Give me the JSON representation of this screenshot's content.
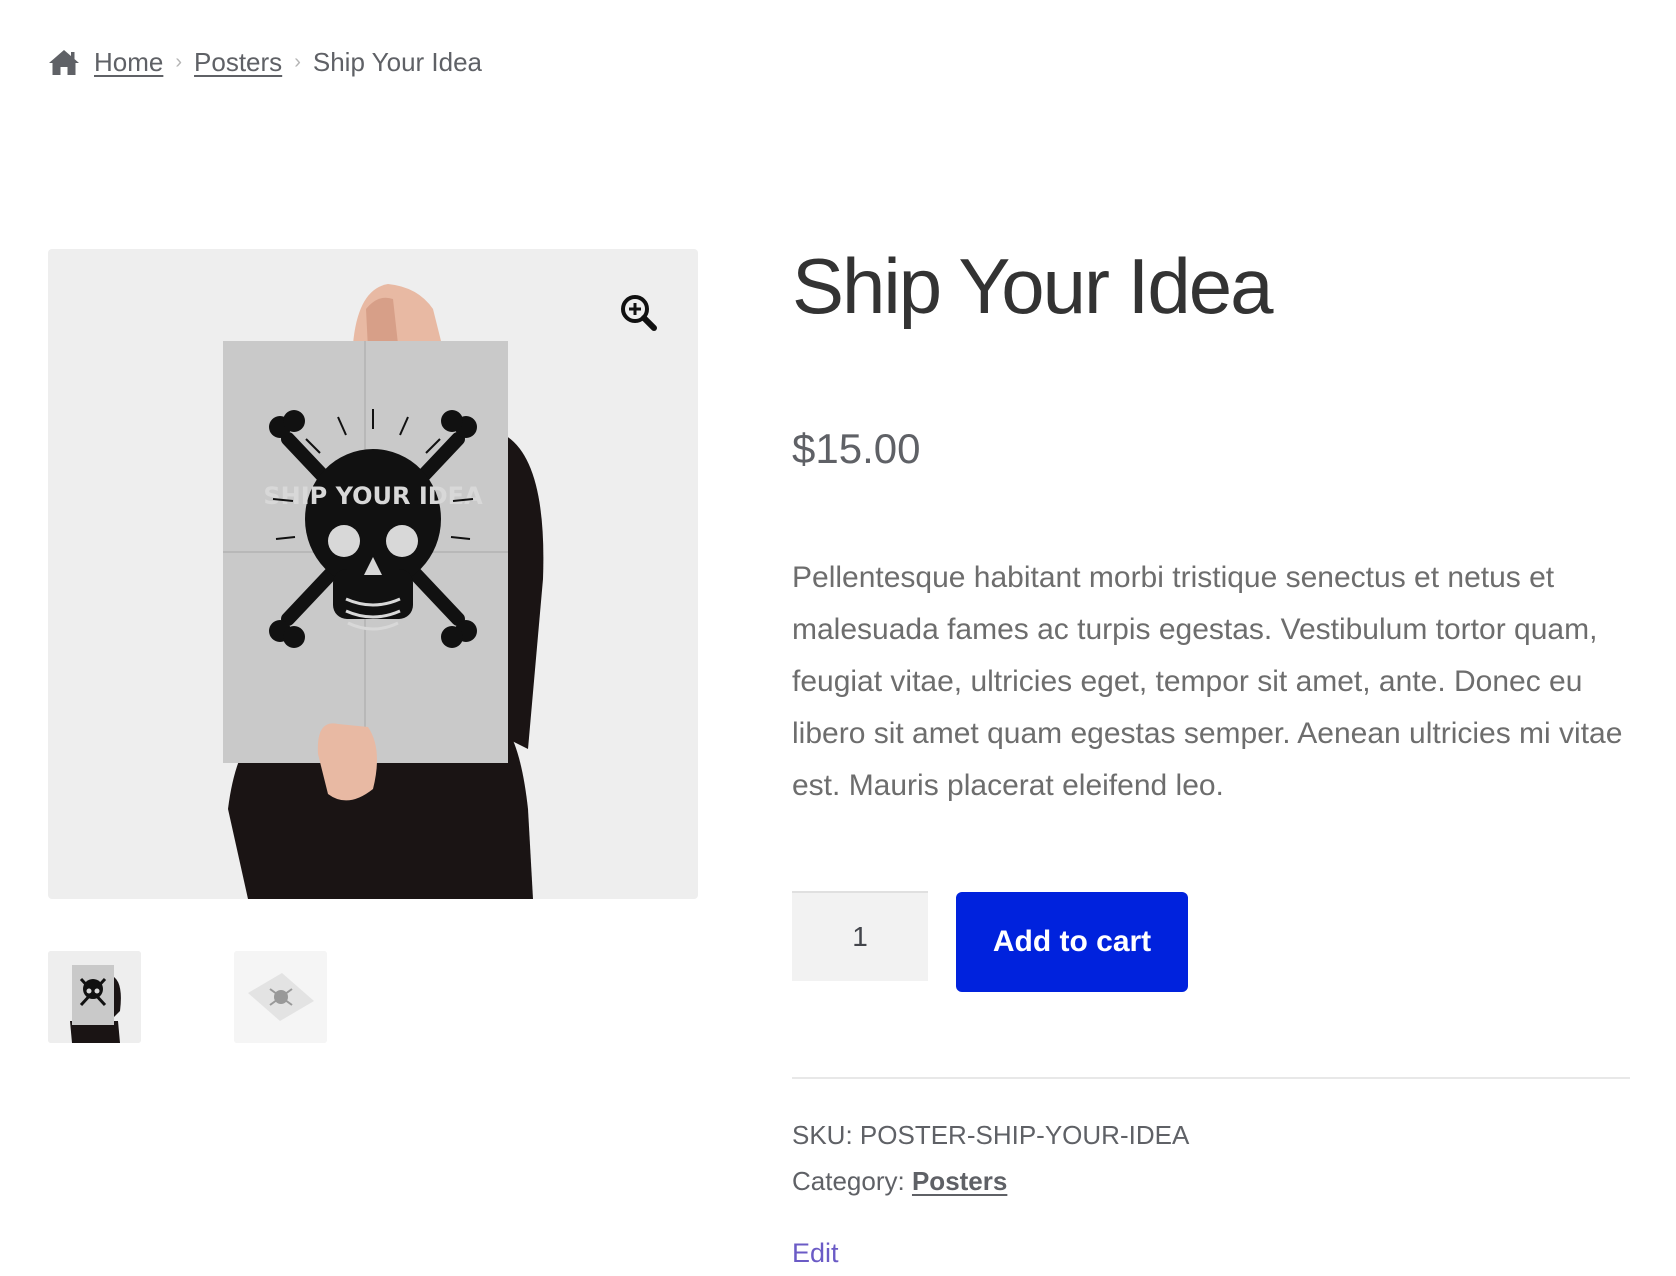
{
  "breadcrumb": {
    "home_icon": "home-icon",
    "home_label": "Home",
    "category_label": "Posters",
    "current_label": "Ship Your Idea",
    "separator": "›"
  },
  "gallery": {
    "zoom_icon": "zoom-in-icon",
    "poster_art_text": "SHIP YOUR IDEA",
    "thumbnails": [
      {
        "name": "thumbnail-person-holding-poster"
      },
      {
        "name": "thumbnail-poster-flat"
      }
    ]
  },
  "product": {
    "title": "Ship Your Idea",
    "price": "$15.00",
    "description": "Pellentesque habitant morbi tristique senectus et netus et malesuada fames ac turpis egestas. Vestibulum tortor quam, feugiat vitae, ultricies eget, tempor sit amet, ante. Donec eu libero sit amet quam egestas semper. Aenean ultricies mi vitae est. Mauris placerat eleifend leo.",
    "quantity": "1",
    "add_to_cart_label": "Add to cart",
    "sku_label": "SKU:",
    "sku_value": "POSTER-SHIP-YOUR-IDEA",
    "category_label": "Category:",
    "category_value": "Posters",
    "edit_label": "Edit"
  },
  "colors": {
    "button": "#0022dd",
    "edit_link": "#6b5bc6",
    "image_bg": "#eeeeee"
  }
}
